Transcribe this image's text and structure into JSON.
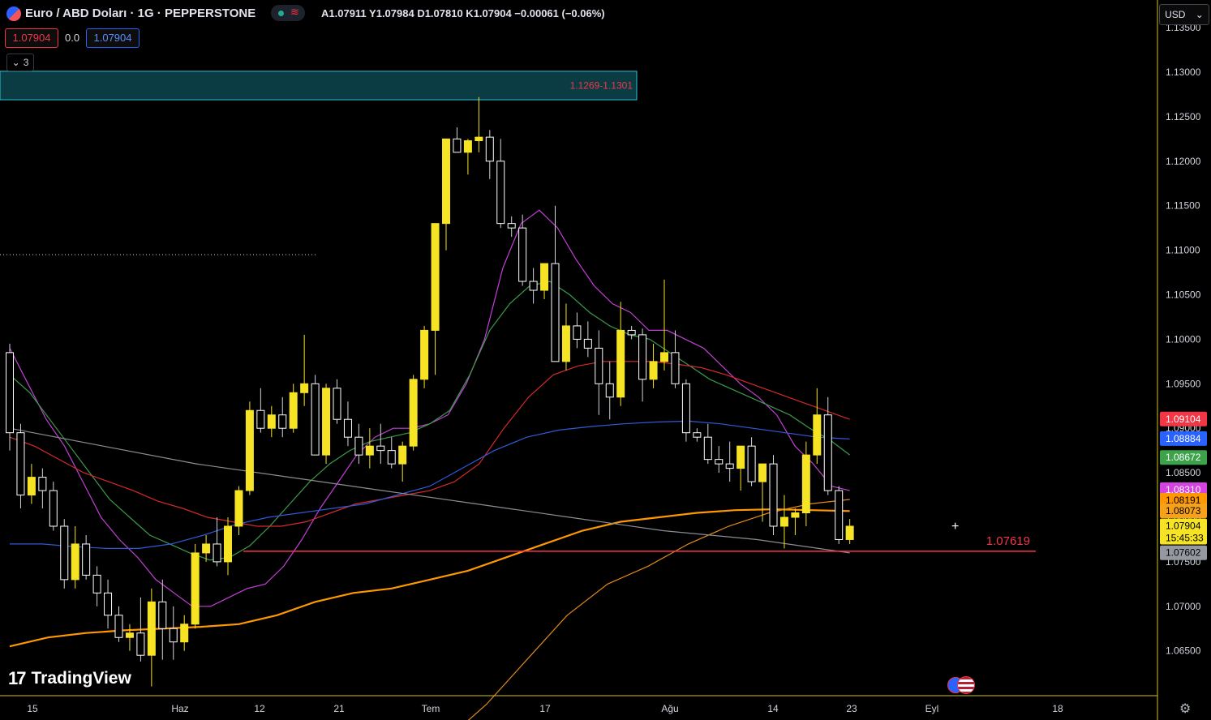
{
  "header": {
    "symbol_title": "Euro / ABD Doları · 1G · PEPPERSTONE",
    "ohlc_text": "A1.07911  Y1.07984  D1.07810  K1.07904  −0.00061 (−0.06%)",
    "sell_price": "1.07904",
    "spread": "0.0",
    "buy_price": "1.07904",
    "indicators_count": "3",
    "currency": "USD"
  },
  "zone_label": "1.1269-1.1301",
  "support_label": "1.07619",
  "countdown": "15:45:33",
  "brand": "TradingView",
  "colors": {
    "up": "#f5e324",
    "down": "#ffffff",
    "ema_magenta": "#c43fd6",
    "ema_green": "#3c9a4a",
    "ema_red": "#d42a2a",
    "ema_blue": "#2f5bd9",
    "ema_orange": "#ff9800",
    "ema_orange2": "#e08a1a",
    "ema_gray": "#8a8d95",
    "support_line": "#f23645",
    "zone": "#26c6da"
  },
  "chart_data": {
    "type": "candlestick",
    "y_axis_ticks": [
      "1.13500",
      "1.13000",
      "1.12500",
      "1.12000",
      "1.11500",
      "1.11000",
      "1.10500",
      "1.10000",
      "1.09500",
      "1.09000",
      "1.08500",
      "1.08000",
      "1.07500",
      "1.07000",
      "1.06500"
    ],
    "x_axis_ticks": [
      "15",
      "Haz",
      "12",
      "21",
      "Tem",
      "17",
      "Ağu",
      "14",
      "23",
      "Eyl",
      "18"
    ],
    "candles": [
      [
        1.0985,
        1.0995,
        1.0875,
        1.0895
      ],
      [
        1.0895,
        1.0905,
        1.081,
        1.0825
      ],
      [
        1.0825,
        1.086,
        1.0815,
        1.0845
      ],
      [
        1.0845,
        1.0855,
        1.081,
        1.083
      ],
      [
        1.083,
        1.084,
        1.0785,
        1.079
      ],
      [
        1.079,
        1.0798,
        1.072,
        1.073
      ],
      [
        1.073,
        1.079,
        1.072,
        1.077
      ],
      [
        1.077,
        1.078,
        1.073,
        1.0735
      ],
      [
        1.0735,
        1.0745,
        1.07,
        1.0715
      ],
      [
        1.0715,
        1.073,
        1.0675,
        1.069
      ],
      [
        1.069,
        1.07,
        1.066,
        1.0665
      ],
      [
        1.0665,
        1.068,
        1.065,
        1.067
      ],
      [
        1.067,
        1.071,
        1.0638,
        1.0645
      ],
      [
        1.0645,
        1.072,
        1.061,
        1.0705
      ],
      [
        1.0705,
        1.073,
        1.064,
        1.0675
      ],
      [
        1.0675,
        1.07,
        1.064,
        1.066
      ],
      [
        1.066,
        1.069,
        1.065,
        1.068
      ],
      [
        1.068,
        1.077,
        1.0675,
        1.076
      ],
      [
        1.076,
        1.078,
        1.075,
        1.077
      ],
      [
        1.077,
        1.08,
        1.0745,
        1.075
      ],
      [
        1.075,
        1.08,
        1.0735,
        1.079
      ],
      [
        1.079,
        1.0835,
        1.078,
        1.083
      ],
      [
        1.083,
        1.093,
        1.0825,
        1.092
      ],
      [
        1.092,
        1.0945,
        1.0895,
        1.09
      ],
      [
        1.09,
        1.0925,
        1.089,
        1.0915
      ],
      [
        1.0915,
        1.0935,
        1.089,
        1.09
      ],
      [
        1.09,
        1.095,
        1.0895,
        1.094
      ],
      [
        1.094,
        1.1005,
        1.0925,
        1.095
      ],
      [
        1.095,
        1.096,
        1.091,
        1.087
      ],
      [
        1.087,
        1.095,
        1.086,
        1.0945
      ],
      [
        1.0945,
        1.0955,
        1.0905,
        1.091
      ],
      [
        1.091,
        1.093,
        1.088,
        1.089
      ],
      [
        1.089,
        1.0905,
        1.086,
        1.087
      ],
      [
        1.087,
        1.09,
        1.0855,
        1.088
      ],
      [
        1.088,
        1.0905,
        1.086,
        1.0875
      ],
      [
        1.0875,
        1.089,
        1.0855,
        1.086
      ],
      [
        1.086,
        1.0885,
        1.084,
        1.088
      ],
      [
        1.088,
        1.096,
        1.0875,
        1.0955
      ],
      [
        1.0955,
        1.1015,
        1.0945,
        1.101
      ],
      [
        1.101,
        1.103,
        1.096,
        1.113
      ],
      [
        1.113,
        1.114,
        1.11,
        1.1225
      ],
      [
        1.1225,
        1.1238,
        1.122,
        1.121
      ],
      [
        1.121,
        1.1225,
        1.1185,
        1.1223
      ],
      [
        1.1223,
        1.1272,
        1.121,
        1.1227
      ],
      [
        1.1227,
        1.1235,
        1.118,
        1.12
      ],
      [
        1.12,
        1.1225,
        1.1125,
        1.113
      ],
      [
        1.113,
        1.1138,
        1.1115,
        1.1125
      ],
      [
        1.1125,
        1.114,
        1.106,
        1.1065
      ],
      [
        1.1065,
        1.108,
        1.104,
        1.1055
      ],
      [
        1.1055,
        1.1085,
        1.1045,
        1.1085
      ],
      [
        1.1085,
        1.115,
        1.098,
        1.0975
      ],
      [
        1.0975,
        1.104,
        1.0965,
        1.1015
      ],
      [
        1.1015,
        1.103,
        1.099,
        1.1
      ],
      [
        1.1,
        1.102,
        1.098,
        1.099
      ],
      [
        1.099,
        1.101,
        1.0915,
        1.095
      ],
      [
        1.095,
        1.0975,
        1.091,
        1.0935
      ],
      [
        1.0935,
        1.1042,
        1.0925,
        1.101
      ],
      [
        1.101,
        1.1015,
        1.1,
        1.1005
      ],
      [
        1.1005,
        1.1012,
        1.093,
        1.0955
      ],
      [
        1.0955,
        1.0995,
        1.0945,
        1.0975
      ],
      [
        1.0975,
        1.1067,
        1.0965,
        1.0985
      ],
      [
        1.0985,
        1.101,
        1.0945,
        1.095
      ],
      [
        1.095,
        1.0955,
        1.0885,
        1.0895
      ],
      [
        1.0895,
        1.09,
        1.0885,
        1.089
      ],
      [
        1.089,
        1.0905,
        1.086,
        1.0865
      ],
      [
        1.0865,
        1.088,
        1.085,
        1.086
      ],
      [
        1.086,
        1.0885,
        1.084,
        1.0855
      ],
      [
        1.0855,
        1.088,
        1.083,
        1.088
      ],
      [
        1.088,
        1.089,
        1.0835,
        1.084
      ],
      [
        1.084,
        1.086,
        1.0795,
        1.086
      ],
      [
        1.086,
        1.087,
        1.078,
        1.079
      ],
      [
        1.079,
        1.0825,
        1.0765,
        1.08
      ],
      [
        1.08,
        1.081,
        1.078,
        1.0805
      ],
      [
        1.0805,
        1.0885,
        1.079,
        1.087
      ],
      [
        1.087,
        1.0945,
        1.086,
        1.0915
      ],
      [
        1.0915,
        1.0935,
        1.0825,
        1.083
      ],
      [
        1.083,
        1.0835,
        1.077,
        1.0775
      ],
      [
        1.0775,
        1.0798,
        1.077,
        1.079
      ]
    ],
    "candle_order": "open,high,low,close",
    "ema_lines": [
      {
        "color_key": "ema_magenta",
        "values": [
          1.099,
          1.095,
          1.091,
          1.088,
          1.084,
          1.08,
          1.0775,
          1.0755,
          1.073,
          1.0715,
          1.07,
          1.07,
          1.071,
          1.072,
          1.0725,
          1.0745,
          1.0775,
          1.081,
          1.084,
          1.087,
          1.089,
          1.09,
          1.09,
          1.0905,
          1.0915,
          1.095,
          1.1,
          1.108,
          1.113,
          1.1145,
          1.1125,
          1.109,
          1.106,
          1.104,
          1.103,
          1.101,
          1.101,
          1.1,
          1.099,
          1.097,
          1.095,
          1.0935,
          1.0915,
          1.088,
          1.086,
          1.0835,
          1.083
        ]
      },
      {
        "color_key": "ema_green",
        "values": [
          1.096,
          1.094,
          1.091,
          1.088,
          1.085,
          1.082,
          1.08,
          1.078,
          1.077,
          1.076,
          1.0752,
          1.0755,
          1.0768,
          1.079,
          1.0815,
          1.084,
          1.086,
          1.0875,
          1.0885,
          1.089,
          1.0895,
          1.0905,
          1.092,
          1.096,
          1.101,
          1.104,
          1.106,
          1.1065,
          1.105,
          1.103,
          1.1015,
          1.1005,
          1.1,
          1.0985,
          1.097,
          1.0955,
          1.0945,
          1.0935,
          1.0925,
          1.0915,
          1.09,
          1.0887,
          1.087
        ]
      },
      {
        "color_key": "ema_red",
        "values": [
          1.089,
          1.088,
          1.0865,
          1.085,
          1.084,
          1.083,
          1.0818,
          1.081,
          1.08,
          1.0795,
          1.079,
          1.079,
          1.0795,
          1.0805,
          1.0815,
          1.082,
          1.0825,
          1.083,
          1.084,
          1.086,
          1.09,
          1.0935,
          1.096,
          1.097,
          1.0975,
          1.0975,
          1.0975,
          1.0972,
          1.0968,
          1.096,
          1.095,
          1.094,
          1.093,
          1.092,
          1.091
        ]
      },
      {
        "color_key": "ema_blue",
        "values": [
          1.077,
          1.077,
          1.0767,
          1.0765,
          1.0765,
          1.077,
          1.078,
          1.0792,
          1.08,
          1.0805,
          1.081,
          1.0815,
          1.0825,
          1.0835,
          1.0855,
          1.0875,
          1.089,
          1.0898,
          1.0902,
          1.0905,
          1.0907,
          1.0908,
          1.0905,
          1.09,
          1.0895,
          1.089,
          1.0888
        ]
      },
      {
        "color_key": "ema_orange",
        "values": [
          1.0655,
          1.0665,
          1.067,
          1.0673,
          1.0675,
          1.0677,
          1.068,
          1.069,
          1.0705,
          1.0715,
          1.072,
          1.073,
          1.074,
          1.0755,
          1.077,
          1.0785,
          1.0795,
          1.08,
          1.0805,
          1.0808,
          1.0809,
          1.0808,
          1.0807
        ]
      },
      {
        "color_key": "ema_orange2",
        "values": [
          1.055,
          1.059,
          1.064,
          1.069,
          1.0725,
          1.0745,
          1.077,
          1.079,
          1.0805,
          1.0815,
          1.082
        ]
      },
      {
        "color_key": "ema_gray",
        "values": [
          1.09,
          1.088,
          1.086,
          1.0845,
          1.083,
          1.0815,
          1.08,
          1.0785,
          1.0775,
          1.076
        ]
      }
    ],
    "resistance_zone": [
      1.1269,
      1.1301
    ],
    "support_level": 1.07619,
    "dotted_level": 1.1095,
    "price_labels": [
      {
        "text": "1.09104",
        "color": "#f23645",
        "value": 1.09104
      },
      {
        "text": "1.08884",
        "color": "#2962ff",
        "value": 1.08884
      },
      {
        "text": "1.08672",
        "color": "#3ca34b",
        "value": 1.08672
      },
      {
        "text": "1.08310",
        "color": "#d544e0",
        "value": 1.0831
      },
      {
        "text": "1.08191",
        "color": "#ff9800",
        "value": 1.08191
      },
      {
        "text": "1.08073",
        "color": "#f7a01a",
        "value": 1.08073
      },
      {
        "text": "1.07904",
        "color": "#f5e324",
        "value": 1.07904
      },
      {
        "text": "1.07602",
        "color": "#9598a1",
        "value": 1.07602
      }
    ]
  }
}
